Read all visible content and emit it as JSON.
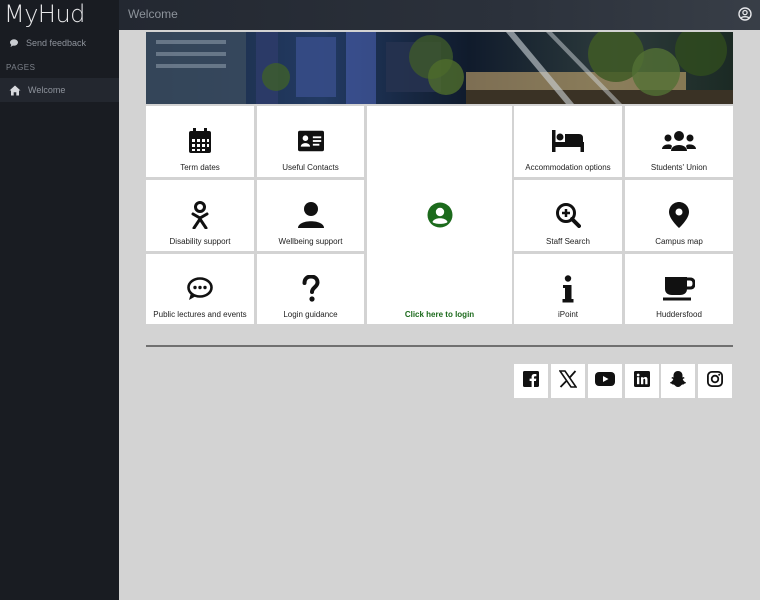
{
  "app": {
    "brand": "MyHud",
    "page_title": "Welcome"
  },
  "sidebar": {
    "feedback_label": "Send feedback",
    "section_label": "PAGES",
    "items": [
      {
        "label": "Welcome",
        "icon": "home-icon",
        "active": true
      }
    ]
  },
  "tiles": {
    "term_dates": "Term dates",
    "useful_contacts": "Useful Contacts",
    "login": "Click here to login",
    "accommodation": "Accommodation options",
    "students_union": "Students' Union",
    "disability": "Disability support",
    "wellbeing": "Wellbeing support",
    "staff_search": "Staff Search",
    "campus_map": "Campus map",
    "lectures": "Public lectures and events",
    "login_guidance": "Login guidance",
    "ipoint": "iPoint",
    "huddersfood": "Huddersfood"
  },
  "social": [
    "facebook-icon",
    "x-icon",
    "youtube-icon",
    "linkedin-icon",
    "snapchat-icon",
    "instagram-icon"
  ],
  "colors": {
    "sidebar": "#191c22",
    "content": "#d3d3d3",
    "login_green": "#1c6a1c"
  }
}
